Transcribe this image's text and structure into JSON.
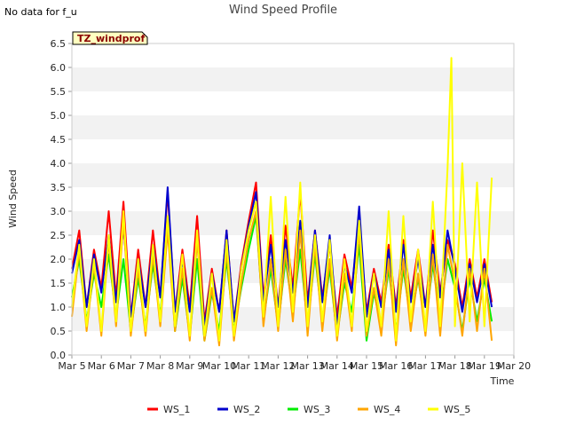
{
  "note": "No data for f_u",
  "chart_data": {
    "type": "line",
    "title": "Wind Speed Profile",
    "xlabel": "Time",
    "ylabel": "Wind Speed",
    "annotation": "TZ_windprof",
    "xlim": [
      5,
      20
    ],
    "ylim": [
      0,
      6.5
    ],
    "x_ticks": [
      "Mar 5",
      "Mar 6",
      "Mar 7",
      "Mar 8",
      "Mar 9",
      "Mar 10",
      "Mar 11",
      "Mar 12",
      "Mar 13",
      "Mar 14",
      "Mar 15",
      "Mar 16",
      "Mar 17",
      "Mar 18",
      "Mar 19",
      "Mar 20"
    ],
    "y_ticks": [
      "0.0",
      "0.5",
      "1.0",
      "1.5",
      "2.0",
      "2.5",
      "3.0",
      "3.5",
      "4.0",
      "4.5",
      "5.0",
      "5.5",
      "6.0",
      "6.5"
    ],
    "grid": "horizontal bands",
    "legend_position": "bottom",
    "series": [
      {
        "name": "WS_1",
        "color": "#ff0000",
        "x": [
          5.0,
          5.25,
          5.5,
          5.75,
          6.0,
          6.25,
          6.5,
          6.75,
          7.0,
          7.25,
          7.5,
          7.75,
          8.0,
          8.25,
          8.5,
          8.75,
          9.0,
          9.25,
          9.5,
          9.75,
          10.0,
          10.25,
          10.5,
          10.75,
          11.0,
          11.25,
          11.5,
          11.75,
          12.0,
          12.25,
          12.5,
          12.75,
          13.0,
          13.25,
          13.5,
          13.75,
          14.0,
          14.25,
          14.5,
          14.75,
          15.0,
          15.25,
          15.5,
          15.75,
          16.0,
          16.25,
          16.5,
          16.75,
          17.0,
          17.25,
          17.5,
          17.75,
          18.0,
          18.25,
          18.5,
          18.75,
          19.0,
          19.25
        ],
        "values": [
          1.8,
          2.6,
          1.0,
          2.2,
          1.4,
          3.0,
          1.2,
          3.2,
          0.8,
          2.2,
          1.0,
          2.6,
          1.2,
          3.4,
          0.9,
          2.2,
          1.0,
          2.9,
          0.7,
          1.8,
          0.9,
          2.6,
          0.7,
          1.9,
          2.8,
          3.6,
          1.2,
          2.5,
          1.0,
          2.7,
          1.4,
          3.4,
          1.1,
          2.6,
          1.2,
          2.3,
          0.8,
          2.1,
          1.4,
          2.8,
          0.9,
          1.8,
          1.1,
          2.3,
          1.0,
          2.4,
          1.2,
          2.2,
          1.0,
          2.6,
          1.3,
          2.4,
          1.9,
          1.0,
          2.0,
          1.2,
          2.0,
          1.1
        ]
      },
      {
        "name": "WS_2",
        "color": "#0000cc",
        "x": [
          5.0,
          5.25,
          5.5,
          5.75,
          6.0,
          6.25,
          6.5,
          6.75,
          7.0,
          7.25,
          7.5,
          7.75,
          8.0,
          8.25,
          8.5,
          8.75,
          9.0,
          9.25,
          9.5,
          9.75,
          10.0,
          10.25,
          10.5,
          10.75,
          11.0,
          11.25,
          11.5,
          11.75,
          12.0,
          12.25,
          12.5,
          12.75,
          13.0,
          13.25,
          13.5,
          13.75,
          14.0,
          14.25,
          14.5,
          14.75,
          15.0,
          15.25,
          15.5,
          15.75,
          16.0,
          16.25,
          16.5,
          16.75,
          17.0,
          17.25,
          17.5,
          17.75,
          18.0,
          18.25,
          18.5,
          18.75,
          19.0,
          19.25
        ],
        "values": [
          1.7,
          2.4,
          1.0,
          2.1,
          1.3,
          2.5,
          1.1,
          2.7,
          0.8,
          2.0,
          1.0,
          2.3,
          1.2,
          3.5,
          0.9,
          2.0,
          0.9,
          2.5,
          0.6,
          1.7,
          0.9,
          2.6,
          0.7,
          1.8,
          2.7,
          3.4,
          1.1,
          2.3,
          1.0,
          2.4,
          1.3,
          2.8,
          1.0,
          2.6,
          1.1,
          2.5,
          0.6,
          1.9,
          1.3,
          3.1,
          0.8,
          1.7,
          1.0,
          2.2,
          0.9,
          2.3,
          1.1,
          2.0,
          1.0,
          2.3,
          1.2,
          2.6,
          1.8,
          0.9,
          1.9,
          1.1,
          1.9,
          1.0
        ]
      },
      {
        "name": "WS_3",
        "color": "#00ee00",
        "x": [
          5.0,
          5.25,
          5.5,
          5.75,
          6.0,
          6.25,
          6.5,
          6.75,
          7.0,
          7.25,
          7.5,
          7.75,
          8.0,
          8.25,
          8.5,
          8.75,
          9.0,
          9.25,
          9.5,
          9.75,
          10.0,
          10.25,
          10.5,
          10.75,
          11.0,
          11.25,
          11.5,
          11.75,
          12.0,
          12.25,
          12.5,
          12.75,
          13.0,
          13.25,
          13.5,
          13.75,
          14.0,
          14.25,
          14.5,
          14.75,
          15.0,
          15.25,
          15.5,
          15.75,
          16.0,
          16.25,
          16.5,
          16.75,
          17.0,
          17.25,
          17.5,
          17.75,
          18.0,
          18.25,
          18.5,
          18.75,
          19.0,
          19.25
        ],
        "values": [
          1.2,
          2.0,
          0.7,
          1.7,
          1.0,
          2.1,
          0.8,
          2.0,
          0.5,
          1.6,
          0.6,
          1.9,
          0.8,
          2.8,
          0.5,
          1.6,
          0.4,
          2.0,
          0.3,
          1.3,
          0.5,
          2.0,
          0.5,
          1.4,
          2.2,
          2.9,
          0.7,
          1.8,
          0.6,
          2.0,
          0.9,
          2.2,
          0.6,
          2.1,
          0.7,
          1.8,
          0.4,
          1.5,
          0.9,
          2.3,
          0.3,
          1.3,
          0.6,
          1.8,
          0.5,
          1.8,
          0.7,
          1.6,
          0.6,
          1.9,
          0.8,
          2.0,
          1.4,
          0.5,
          1.6,
          0.7,
          1.6,
          0.7
        ]
      },
      {
        "name": "WS_4",
        "color": "#ffa500",
        "x": [
          5.0,
          5.25,
          5.5,
          5.75,
          6.0,
          6.25,
          6.5,
          6.75,
          7.0,
          7.25,
          7.5,
          7.75,
          8.0,
          8.25,
          8.5,
          8.75,
          9.0,
          9.25,
          9.5,
          9.75,
          10.0,
          10.25,
          10.5,
          10.75,
          11.0,
          11.25,
          11.5,
          11.75,
          12.0,
          12.25,
          12.5,
          12.75,
          13.0,
          13.25,
          13.5,
          13.75,
          14.0,
          14.25,
          14.5,
          14.75,
          15.0,
          15.25,
          15.5,
          15.75,
          16.0,
          16.25,
          16.5,
          16.75,
          17.0,
          17.25,
          17.5,
          17.75,
          18.0,
          18.25,
          18.5,
          18.75,
          19.0,
          19.25
        ],
        "values": [
          0.8,
          2.2,
          0.5,
          1.9,
          0.4,
          2.4,
          0.6,
          2.8,
          0.4,
          1.8,
          0.4,
          2.1,
          0.6,
          2.6,
          0.5,
          1.8,
          0.3,
          2.4,
          0.3,
          1.4,
          0.2,
          2.2,
          0.3,
          1.5,
          2.4,
          3.0,
          0.6,
          2.0,
          0.5,
          2.2,
          0.7,
          2.6,
          0.4,
          2.3,
          0.5,
          2.0,
          0.3,
          1.7,
          0.5,
          2.6,
          0.4,
          1.4,
          0.4,
          2.0,
          0.2,
          2.0,
          0.5,
          1.7,
          0.4,
          2.1,
          0.4,
          2.3,
          1.5,
          0.4,
          1.8,
          0.5,
          1.8,
          0.3
        ]
      },
      {
        "name": "WS_5",
        "color": "#ffff00",
        "x": [
          5.0,
          5.25,
          5.5,
          5.75,
          6.0,
          6.25,
          6.5,
          6.75,
          7.0,
          7.25,
          7.5,
          7.75,
          8.0,
          8.25,
          8.5,
          8.75,
          9.0,
          9.25,
          9.5,
          9.75,
          10.0,
          10.25,
          10.5,
          10.75,
          11.0,
          11.25,
          11.5,
          11.75,
          12.0,
          12.25,
          12.5,
          12.75,
          13.0,
          13.25,
          13.5,
          13.75,
          14.0,
          14.25,
          14.5,
          14.75,
          15.0,
          15.25,
          15.5,
          15.75,
          16.0,
          16.25,
          16.5,
          16.75,
          17.0,
          17.25,
          17.5,
          17.75,
          17.88,
          18.0,
          18.25,
          18.5,
          18.75,
          19.0,
          19.25
        ],
        "values": [
          1.0,
          2.3,
          0.6,
          2.0,
          0.5,
          2.5,
          0.7,
          3.0,
          0.5,
          2.0,
          0.5,
          2.3,
          0.7,
          2.9,
          0.6,
          2.1,
          0.4,
          2.6,
          0.4,
          1.7,
          0.3,
          2.4,
          0.4,
          1.8,
          2.6,
          3.2,
          0.8,
          3.3,
          0.6,
          3.3,
          0.9,
          3.6,
          0.6,
          2.5,
          0.7,
          2.4,
          0.4,
          2.0,
          0.6,
          2.8,
          0.5,
          1.7,
          0.6,
          3.0,
          0.3,
          2.9,
          0.7,
          2.2,
          0.5,
          3.2,
          0.6,
          3.9,
          6.2,
          0.6,
          4.0,
          0.7,
          3.6,
          0.6,
          3.7
        ]
      }
    ]
  },
  "legend": {
    "items": [
      {
        "label": "WS_1",
        "color": "#ff0000"
      },
      {
        "label": "WS_2",
        "color": "#0000cc"
      },
      {
        "label": "WS_3",
        "color": "#00ee00"
      },
      {
        "label": "WS_4",
        "color": "#ffa500"
      },
      {
        "label": "WS_5",
        "color": "#ffff00"
      }
    ]
  }
}
